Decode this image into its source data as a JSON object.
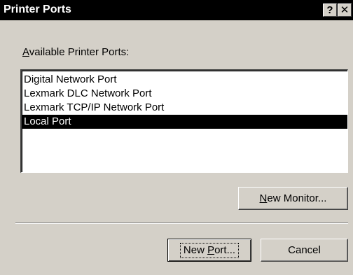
{
  "window": {
    "title": "Printer Ports",
    "help_glyph": "?",
    "close_glyph": "✕"
  },
  "ports": {
    "label_accel": "A",
    "label_rest": "vailable Printer Ports:",
    "items": [
      {
        "label": "Digital Network Port",
        "selected": false
      },
      {
        "label": "Lexmark DLC Network Port",
        "selected": false
      },
      {
        "label": "Lexmark TCP/IP Network Port",
        "selected": false
      },
      {
        "label": "Local Port",
        "selected": true
      }
    ]
  },
  "buttons": {
    "new_monitor_accel": "N",
    "new_monitor_rest": "ew Monitor...",
    "new_port_pre": "New ",
    "new_port_accel": "P",
    "new_port_rest": "ort...",
    "cancel": "Cancel"
  }
}
